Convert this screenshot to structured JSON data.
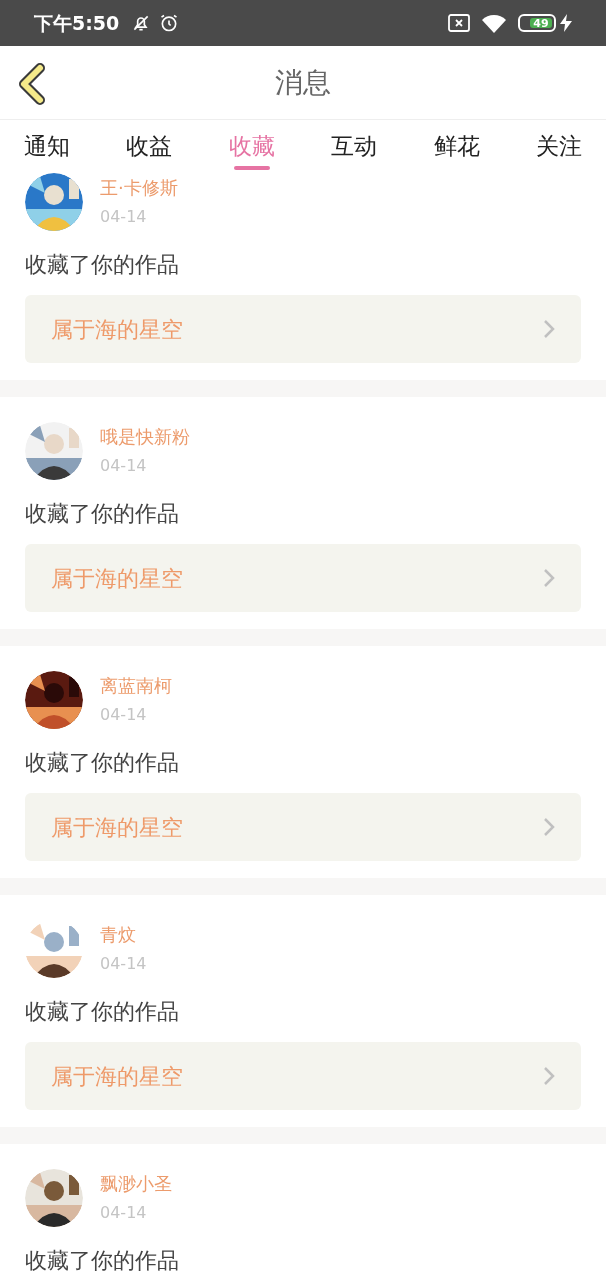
{
  "status_bar": {
    "time": "下午5:50",
    "battery": "49"
  },
  "header": {
    "title": "消息"
  },
  "tabs": [
    {
      "label": "通知",
      "selected": false
    },
    {
      "label": "收益",
      "selected": false
    },
    {
      "label": "收藏",
      "selected": true
    },
    {
      "label": "互动",
      "selected": false
    },
    {
      "label": "鲜花",
      "selected": false
    },
    {
      "label": "关注",
      "selected": false
    }
  ],
  "messages": [
    {
      "name": "王·卡修斯",
      "date": "04-14",
      "text": "收藏了你的作品",
      "work": "属于海的星空"
    },
    {
      "name": "哦是快新粉",
      "date": "04-14",
      "text": "收藏了你的作品",
      "work": "属于海的星空"
    },
    {
      "name": "离蓝南柯",
      "date": "04-14",
      "text": "收藏了你的作品",
      "work": "属于海的星空"
    },
    {
      "name": "青炆",
      "date": "04-14",
      "text": "收藏了你的作品",
      "work": "属于海的星空"
    },
    {
      "name": "飘渺小圣",
      "date": "04-14",
      "text": "收藏了你的作品"
    }
  ]
}
